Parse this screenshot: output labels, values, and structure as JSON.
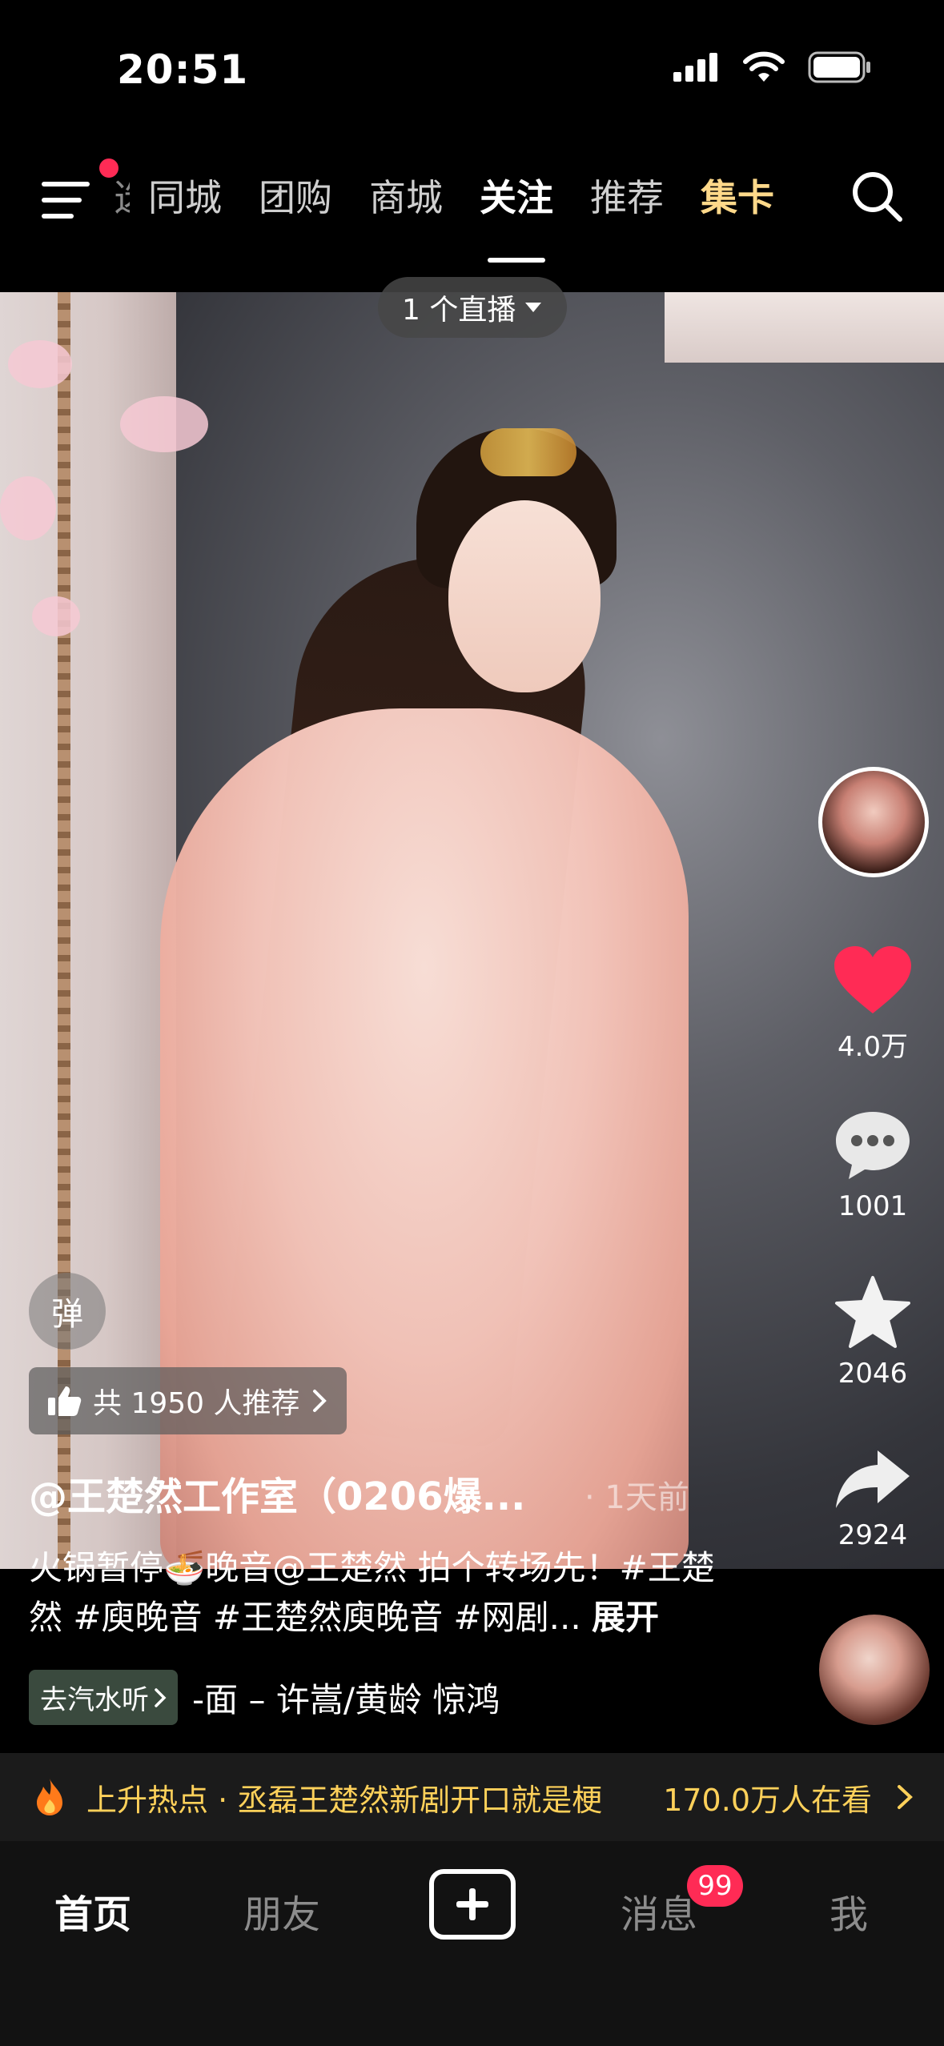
{
  "status": {
    "time": "20:51"
  },
  "topnav": {
    "tabs": [
      {
        "label": "选"
      },
      {
        "label": "同城"
      },
      {
        "label": "团购"
      },
      {
        "label": "商城"
      },
      {
        "label": "关注"
      },
      {
        "label": "推荐"
      },
      {
        "label": "集卡"
      }
    ],
    "active_tab": "关注"
  },
  "video": {
    "live_pill": "1 个直播",
    "danmu": "弹",
    "recommend": "共 1950 人推荐",
    "author": "@王楚然工作室（0206爆...",
    "time_ago": "· 1天前",
    "description": "火锅暂停🍜晚音@王楚然 拍个转场先！#王楚然 #庾晚音 #王楚然庾晚音 #网剧...",
    "expand": "展开",
    "music_tag": "去汽水听",
    "music_text": "-面 – 许嵩/黄龄    惊鸿"
  },
  "actions": {
    "likes": "4.0万",
    "comments": "1001",
    "favorites": "2046",
    "shares": "2924"
  },
  "hotbar": {
    "text": "上升热点 · 丞磊王楚然新剧开口就是梗",
    "count": "170.0万人在看"
  },
  "bottomnav": {
    "home": "首页",
    "friends": "朋友",
    "messages": "消息",
    "messages_badge": "99",
    "me": "我"
  },
  "colors": {
    "accent": "#ff2b55",
    "gold": "#ffd98a",
    "hot": "#ffd15a"
  }
}
